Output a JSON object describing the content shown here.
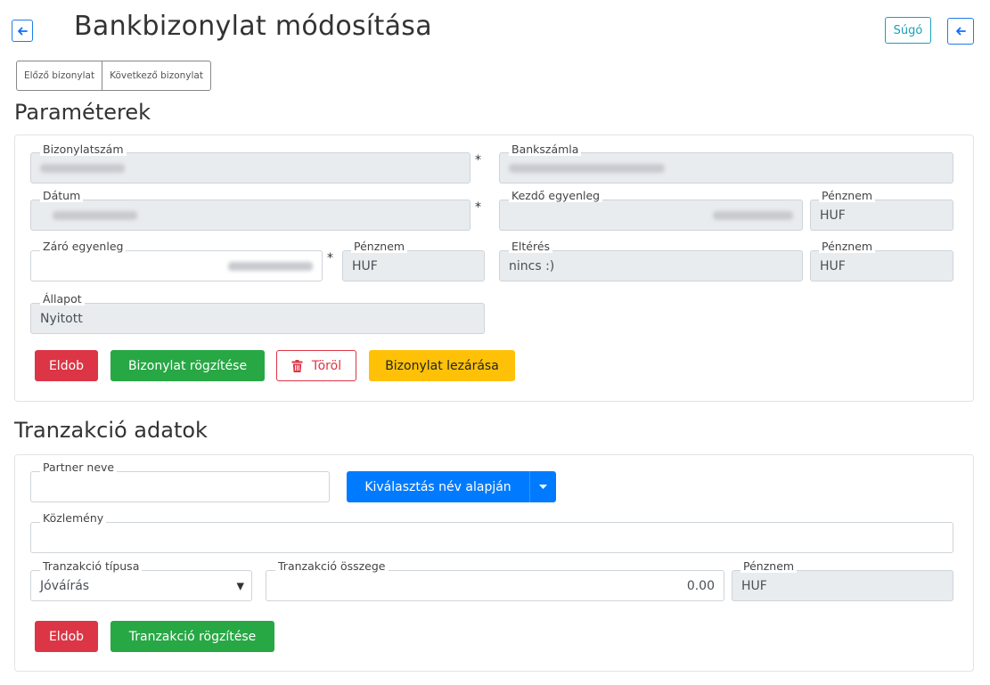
{
  "header": {
    "title": "Bankbizonylat módosítása",
    "help_label": "Súgó",
    "back_icon": "arrow-left-icon"
  },
  "nav": {
    "prev_label": "Előző bizonylat",
    "next_label": "Következő bizonylat"
  },
  "params": {
    "section_title": "Paraméterek",
    "doc_number_label": "Bizonylatszám",
    "bank_account_label": "Bankszámla",
    "date_label": "Dátum",
    "opening_balance_label": "Kezdő egyenleg",
    "currency_label": "Pénznem",
    "currency_value": "HUF",
    "closing_balance_label": "Záró egyenleg",
    "difference_label": "Eltérés",
    "difference_value": "nincs :)",
    "status_label": "Állapot",
    "status_value": "Nyitott",
    "required_mark": "*",
    "discard_label": "Eldob",
    "save_label": "Bizonylat rögzítése",
    "delete_label": "Töröl",
    "close_label": "Bizonylat lezárása"
  },
  "transaction": {
    "section_title": "Tranzakció adatok",
    "partner_label": "Partner neve",
    "partner_value": "",
    "select_by_name_label": "Kiválasztás név alapján",
    "memo_label": "Közlemény",
    "memo_value": "",
    "type_label": "Tranzakció típusa",
    "type_value": "Jóváírás",
    "amount_label": "Tranzakció összege",
    "amount_value": "0.00",
    "currency_label": "Pénznem",
    "currency_value": "HUF",
    "discard_label": "Eldob",
    "save_label": "Tranzakció rögzítése"
  },
  "colors": {
    "primary": "#007bff",
    "danger": "#dc3545",
    "success": "#28a745",
    "warning": "#ffc107",
    "info": "#17a2b8"
  }
}
